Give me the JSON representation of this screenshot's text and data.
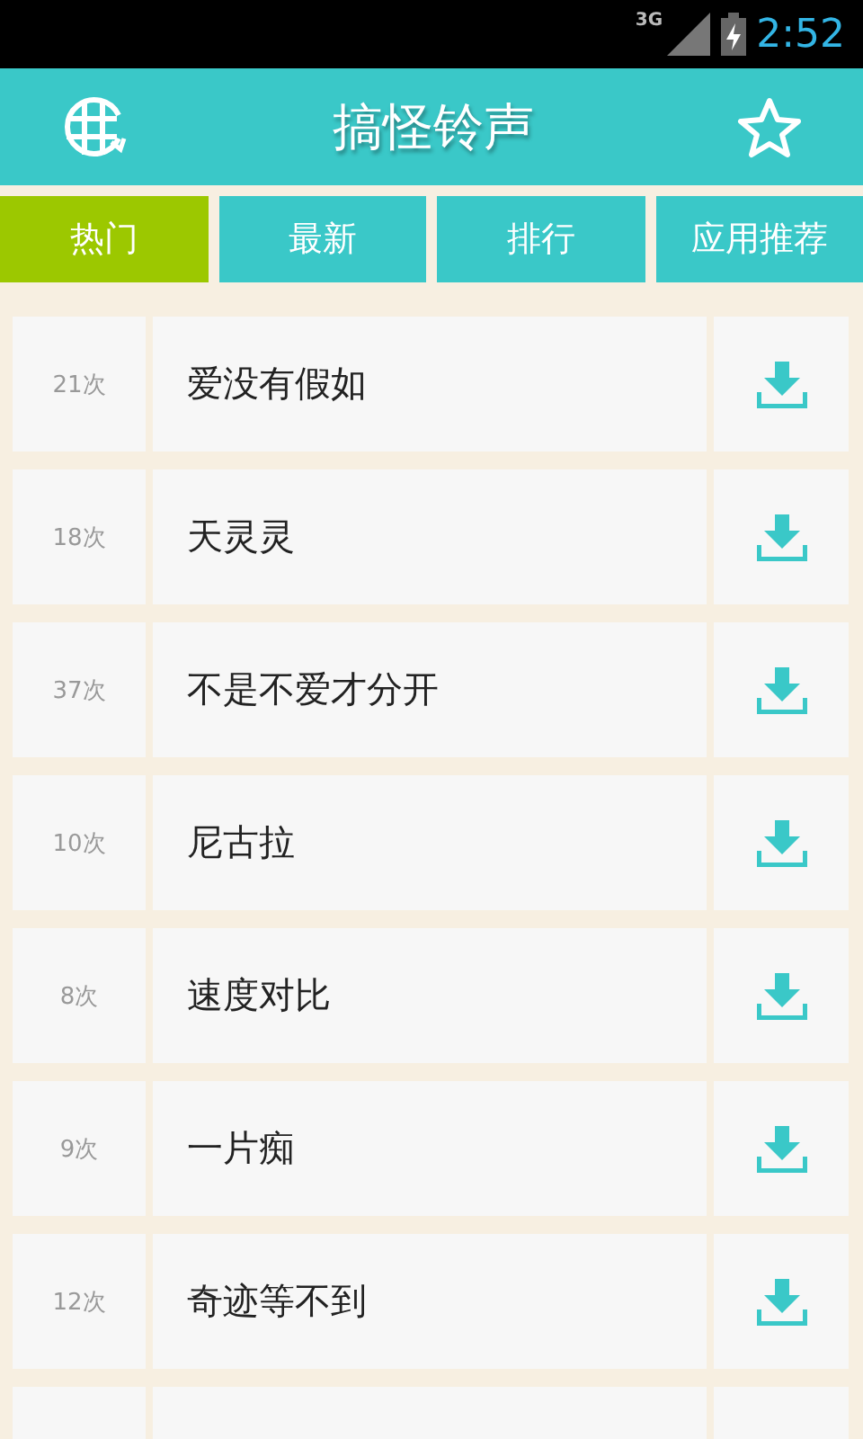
{
  "status_bar": {
    "network": "3G",
    "time": "2:52"
  },
  "header": {
    "title": "搞怪铃声"
  },
  "tabs": [
    {
      "label": "热门",
      "selected": true
    },
    {
      "label": "最新",
      "selected": false
    },
    {
      "label": "排行",
      "selected": false
    },
    {
      "label": "应用推荐",
      "selected": false
    }
  ],
  "ringtones": [
    {
      "count": "21次",
      "title": "爱没有假如"
    },
    {
      "count": "18次",
      "title": "天灵灵"
    },
    {
      "count": "37次",
      "title": "不是不爱才分开"
    },
    {
      "count": "10次",
      "title": "尼古拉"
    },
    {
      "count": "8次",
      "title": "速度对比"
    },
    {
      "count": "9次",
      "title": "一片痴"
    },
    {
      "count": "12次",
      "title": "奇迹等不到"
    }
  ]
}
